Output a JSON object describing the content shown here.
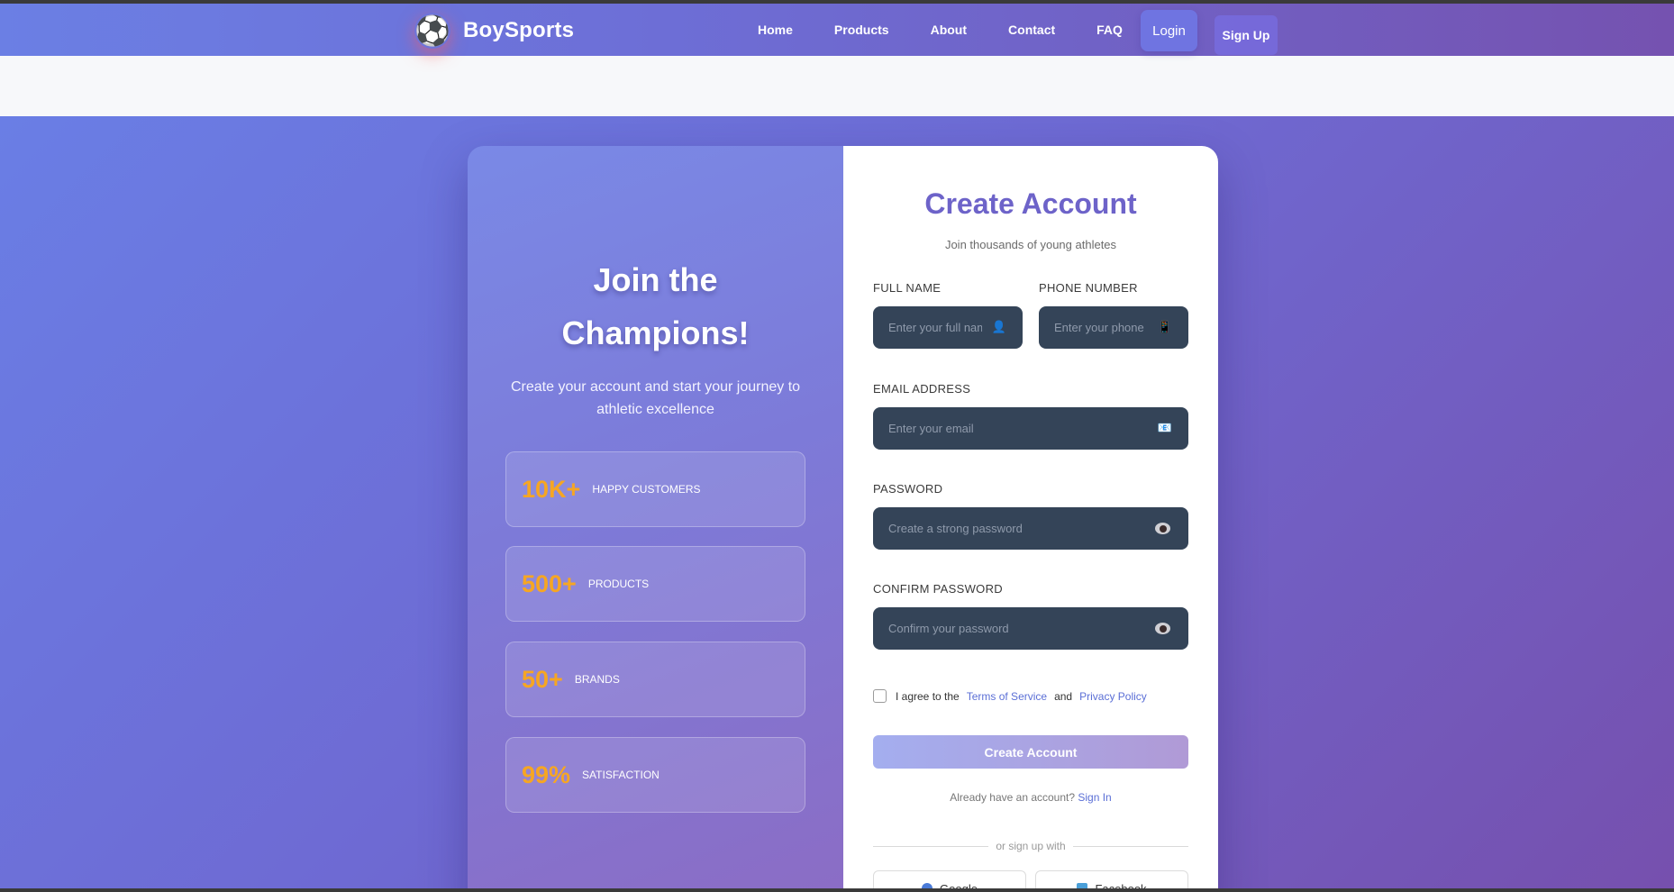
{
  "brand": {
    "name": "BoySports",
    "logo_icon": "⚽"
  },
  "nav": {
    "links": [
      "Home",
      "Products",
      "About",
      "Contact",
      "FAQ"
    ],
    "login_label": "Login",
    "signup_label": "Sign Up"
  },
  "left_panel": {
    "title_line1": "Join the",
    "title_line2": "Champions!",
    "subtitle": "Create your account and start your journey to athletic excellence",
    "stats": [
      {
        "value": "10K+",
        "label": "HAPPY CUSTOMERS"
      },
      {
        "value": "500+",
        "label": "PRODUCTS"
      },
      {
        "value": "50+",
        "label": "BRANDS"
      },
      {
        "value": "99%",
        "label": "SATISFACTION"
      }
    ]
  },
  "form": {
    "title": "Create Account",
    "subtitle": "Join thousands of young athletes",
    "full_name": {
      "label": "FULL NAME",
      "placeholder": "Enter your full name",
      "icon": "👤"
    },
    "phone": {
      "label": "PHONE NUMBER",
      "placeholder": "Enter your phone",
      "icon": "📱"
    },
    "email": {
      "label": "EMAIL ADDRESS",
      "placeholder": "Enter your email",
      "icon": "📧"
    },
    "password": {
      "label": "PASSWORD",
      "placeholder": "Create a strong password"
    },
    "confirm_password": {
      "label": "CONFIRM PASSWORD",
      "placeholder": "Confirm your password"
    },
    "terms": {
      "prefix": "I agree to the",
      "tos": "Terms of Service",
      "and": "and",
      "privacy": "Privacy Policy"
    },
    "submit_label": "Create Account",
    "signin_prompt": "Already have an account?",
    "signin_link": "Sign In",
    "divider_text": "or sign up with",
    "social": {
      "google": "Google",
      "facebook": "Facebook"
    }
  },
  "colors": {
    "nav_gradient_start": "#6b7fe4",
    "nav_gradient_end": "#7552b0",
    "accent": "#6d63c9",
    "stat_value": "#f6a623",
    "input_bg": "#344458",
    "link": "#5b6fd6"
  }
}
